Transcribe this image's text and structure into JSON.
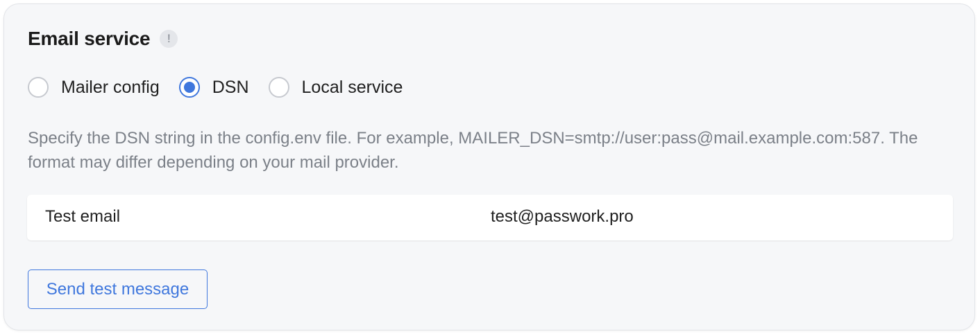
{
  "section": {
    "title": "Email service",
    "info_icon": "!"
  },
  "mail_mode": {
    "options": [
      {
        "label": "Mailer config",
        "selected": false
      },
      {
        "label": "DSN",
        "selected": true
      },
      {
        "label": "Local service",
        "selected": false
      }
    ]
  },
  "description": "Specify the DSN string in the config.env file. For example, MAILER_DSN=smtp://user:pass@mail.example.com:587. The format may differ depending on your mail provider.",
  "test_email": {
    "label": "Test email",
    "value": "test@passwork.pro"
  },
  "send_button": {
    "label": "Send test message"
  },
  "colors": {
    "accent": "#3f77dd",
    "card_background": "#f6f7f9",
    "muted_text": "#7b8088"
  }
}
